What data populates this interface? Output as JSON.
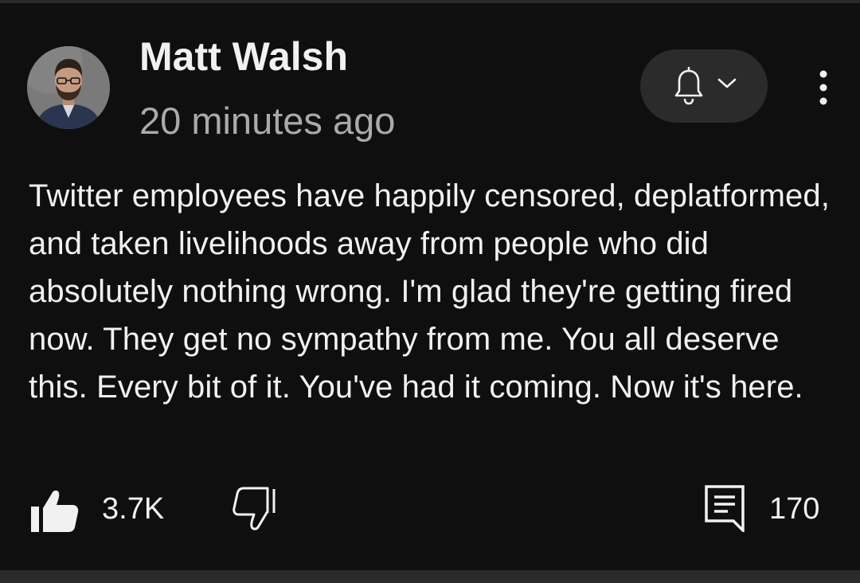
{
  "post": {
    "author": "Matt Walsh",
    "timestamp": "20 minutes ago",
    "text": "Twitter employees have happily censored, deplatformed, and taken livelihoods away from people who did absolutely nothing wrong. I'm glad they're getting fired now. They get no sympathy from me. You all deserve this. Every bit of it. You've had it coming. Now it's here.",
    "likes": "3.7K",
    "comments": "170"
  },
  "icons": {
    "subscribe": "bell-icon",
    "dropdown": "chevron-down-icon",
    "more": "more-vert-icon",
    "like": "thumbs-up-filled-icon",
    "dislike": "thumbs-down-icon",
    "comment": "comment-icon"
  },
  "colors": {
    "background": "#0f0f0f",
    "text_primary": "#f1f1f1",
    "text_secondary": "#aaaaaa",
    "pill": "#2b2b2b"
  }
}
